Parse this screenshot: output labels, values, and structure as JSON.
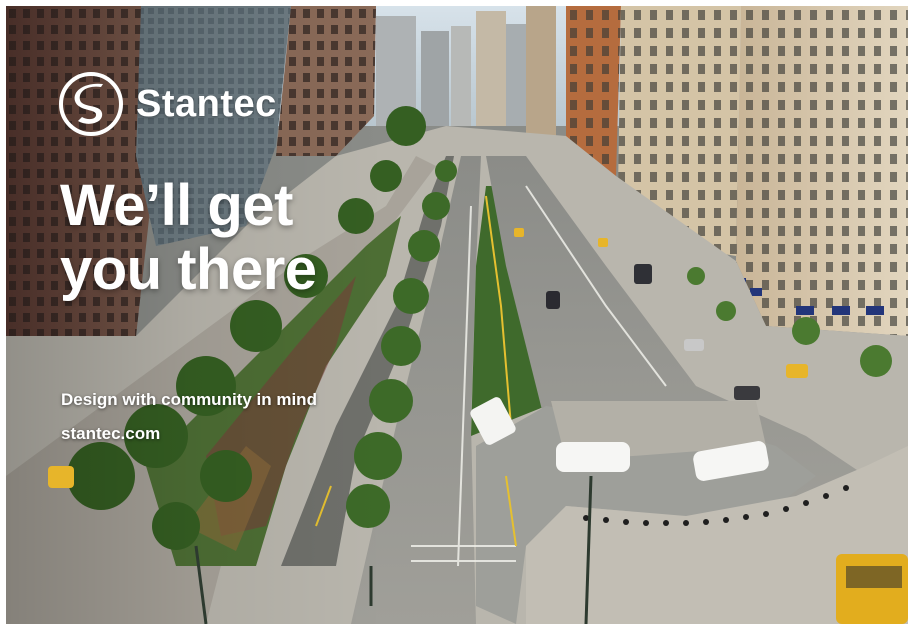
{
  "brand": {
    "name": "Stantec",
    "logo_icon": "stantec-s-mark-icon"
  },
  "headline": {
    "line1": "We’ll get",
    "line2": "you there"
  },
  "tagline": "Design with community in mind",
  "url": "stantec.com",
  "photo": {
    "subject": "aerial city boulevard with tree-lined median and skyscrapers",
    "colors": {
      "sky": "#c9d6e0",
      "road": "#9a9b96",
      "trees": "#3f6a2c",
      "plaza": "#b8b5ac",
      "building_warm": "#b98a62",
      "building_stone": "#d9cdb6",
      "taxi": "#e7b52a"
    }
  }
}
